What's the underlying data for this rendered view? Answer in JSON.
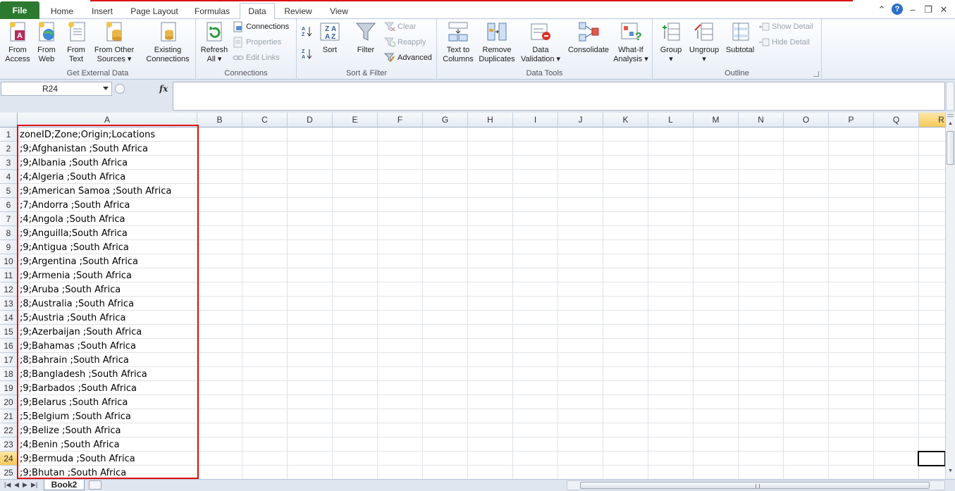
{
  "ribbon_tabs": [
    {
      "label": "File"
    },
    {
      "label": "Home"
    },
    {
      "label": "Insert"
    },
    {
      "label": "Page Layout"
    },
    {
      "label": "Formulas"
    },
    {
      "label": "Data",
      "active": true
    },
    {
      "label": "Review"
    },
    {
      "label": "View"
    }
  ],
  "groups": {
    "external": {
      "label": "Get External Data",
      "from_access": "From\nAccess",
      "from_web": "From\nWeb",
      "from_text": "From\nText",
      "from_other": "From Other\nSources ▾",
      "existing": "Existing\nConnections"
    },
    "connections": {
      "label": "Connections",
      "refresh": "Refresh\nAll ▾",
      "connections": "Connections",
      "properties": "Properties",
      "edit_links": "Edit Links"
    },
    "sortfilter": {
      "label": "Sort & Filter",
      "sort": "Sort",
      "filter": "Filter",
      "clear": "Clear",
      "reapply": "Reapply",
      "advanced": "Advanced"
    },
    "datatools": {
      "label": "Data Tools",
      "text_to_columns": "Text to\nColumns",
      "remove_duplicates": "Remove\nDuplicates",
      "data_validation": "Data\nValidation ▾",
      "consolidate": "Consolidate",
      "whatif": "What-If\nAnalysis ▾"
    },
    "outline": {
      "label": "Outline",
      "group": "Group\n▾",
      "ungroup": "Ungroup\n▾",
      "subtotal": "Subtotal",
      "show_detail": "Show Detail",
      "hide_detail": "Hide Detail"
    }
  },
  "formula_bar": {
    "name_box": "R24",
    "fx": "fx",
    "formula": ""
  },
  "columns": [
    "A",
    "B",
    "C",
    "D",
    "E",
    "F",
    "G",
    "H",
    "I",
    "J",
    "K",
    "L",
    "M",
    "N",
    "O",
    "P",
    "Q",
    "R"
  ],
  "selected_column": "R",
  "selected_row": "24",
  "rows": [
    {
      "n": "1",
      "a": "zoneID;Zone;Origin;Locations"
    },
    {
      "n": "2",
      "a": ";9;Afghanistan ;South Africa"
    },
    {
      "n": "3",
      "a": ";9;Albania ;South Africa"
    },
    {
      "n": "4",
      "a": ";4;Algeria ;South Africa"
    },
    {
      "n": "5",
      "a": ";9;American Samoa ;South Africa"
    },
    {
      "n": "6",
      "a": ";7;Andorra ;South Africa"
    },
    {
      "n": "7",
      "a": ";4;Angola ;South Africa"
    },
    {
      "n": "8",
      "a": ";9;Anguilla;South Africa"
    },
    {
      "n": "9",
      "a": ";9;Antigua ;South Africa"
    },
    {
      "n": "10",
      "a": ";9;Argentina ;South Africa"
    },
    {
      "n": "11",
      "a": ";9;Armenia ;South Africa"
    },
    {
      "n": "12",
      "a": ";9;Aruba ;South Africa"
    },
    {
      "n": "13",
      "a": ";8;Australia ;South Africa"
    },
    {
      "n": "14",
      "a": ";5;Austria ;South Africa"
    },
    {
      "n": "15",
      "a": ";9;Azerbaijan ;South Africa"
    },
    {
      "n": "16",
      "a": ";9;Bahamas ;South Africa"
    },
    {
      "n": "17",
      "a": ";8;Bahrain ;South Africa"
    },
    {
      "n": "18",
      "a": ";8;Bangladesh ;South Africa"
    },
    {
      "n": "19",
      "a": ";9;Barbados ;South Africa"
    },
    {
      "n": "20",
      "a": ";9;Belarus ;South Africa"
    },
    {
      "n": "21",
      "a": ";5;Belgium ;South Africa"
    },
    {
      "n": "22",
      "a": ";9;Belize ;South Africa"
    },
    {
      "n": "23",
      "a": ";4;Benin ;South Africa"
    },
    {
      "n": "24",
      "a": ";9;Bermuda ;South Africa"
    },
    {
      "n": "25",
      "a": ";9;Bhutan ;South Africa"
    }
  ],
  "sheet_tabs": [
    {
      "label": "Book2"
    }
  ],
  "colors": {
    "file_tab": "#2c7a2f",
    "highlight": "#e01010",
    "selected_header": "#f7c95c"
  }
}
